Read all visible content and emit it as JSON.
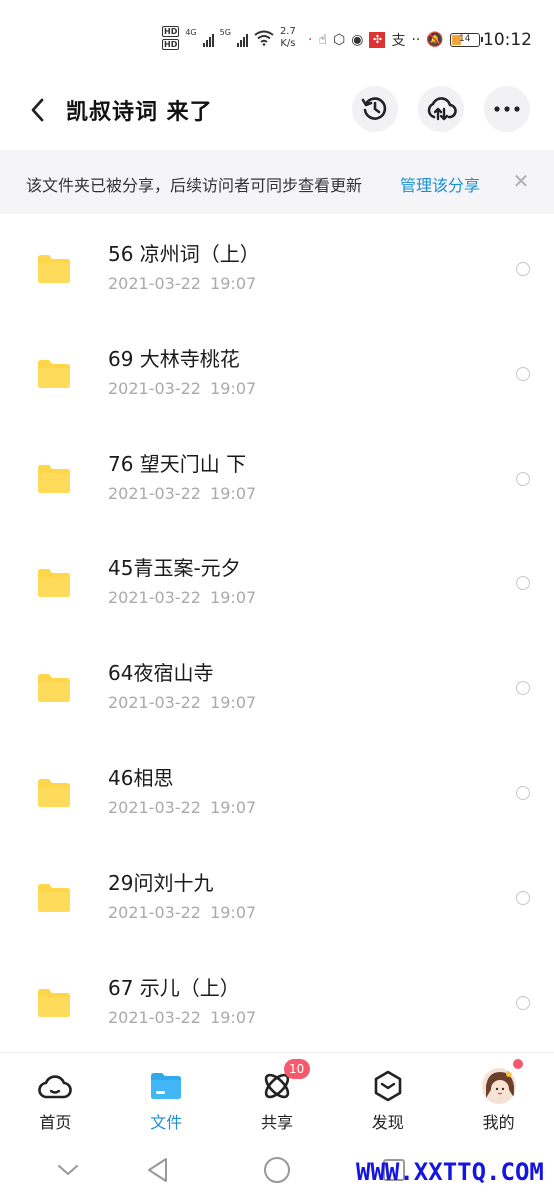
{
  "status_bar": {
    "network_label_1": "4G",
    "network_label_2": "5G",
    "speed_value": "2.7",
    "speed_unit": "K/s",
    "battery_level": "14",
    "time": "10:12",
    "icons": [
      "hd-icon",
      "signal-icon",
      "wifi-icon",
      "app-icon",
      "notification-muted-icon",
      "battery-icon"
    ]
  },
  "header": {
    "title": "凯叔诗词 来了",
    "icons": [
      "back-arrow-icon",
      "history-icon",
      "cloud-sync-icon",
      "more-icon"
    ]
  },
  "banner": {
    "text": "该文件夹已被分享，后续访问者可同步查看更新",
    "link": "管理该分享",
    "close": "✕"
  },
  "files": [
    {
      "name": "56 凉州词（上）",
      "date": "2021-03-22 19:07"
    },
    {
      "name": "69 大林寺桃花",
      "date": "2021-03-22 19:07"
    },
    {
      "name": "76 望天门山 下",
      "date": "2021-03-22 19:07"
    },
    {
      "name": "45青玉案-元夕",
      "date": "2021-03-22 19:07"
    },
    {
      "name": "64夜宿山寺",
      "date": "2021-03-22 19:07"
    },
    {
      "name": "46相思",
      "date": "2021-03-22 19:07"
    },
    {
      "name": "29问刘十九",
      "date": "2021-03-22 19:07"
    },
    {
      "name": "67 示儿（上）",
      "date": "2021-03-22 19:07"
    }
  ],
  "bottom_nav": {
    "home": "首页",
    "files": "文件",
    "share": "共享",
    "share_badge": "10",
    "discover": "发现",
    "me": "我的"
  },
  "watermark": "WWW.XXTTQ.COM",
  "colors": {
    "accent": "#1a8fd6",
    "folder": "#ffd54a",
    "badge": "#f45a6e"
  }
}
